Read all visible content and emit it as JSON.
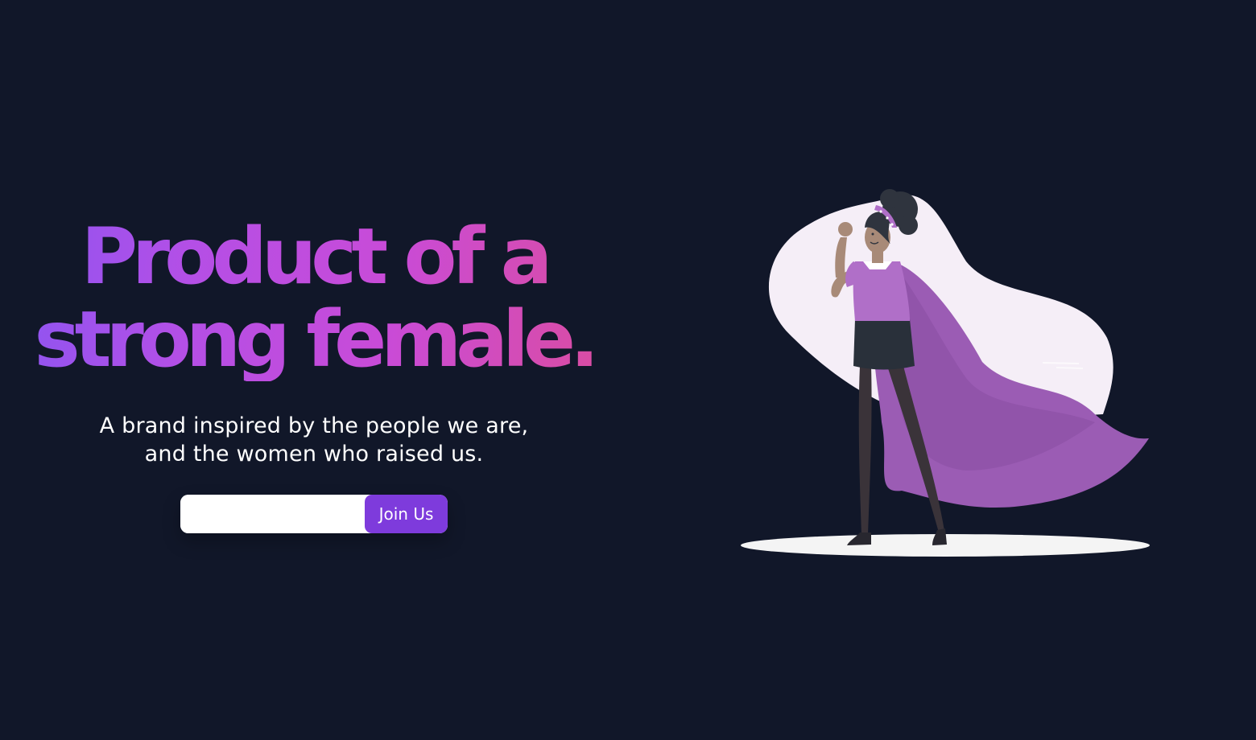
{
  "hero": {
    "headline_line1": "Product of a",
    "headline_line2": "strong female.",
    "subtitle_line1": "A brand inspired by the people we are,",
    "subtitle_line2": "and the women who raised us.",
    "email_input": {
      "value": "",
      "placeholder": ""
    },
    "cta_label": "Join Us"
  },
  "illustration": {
    "name": "superhero-woman-illustration"
  },
  "colors": {
    "background": "#111729",
    "headline_gradient_start": "#8a55f2",
    "headline_gradient_end": "#dc4d9c",
    "cta_button": "#7e3bdc",
    "cape": "#9b5cb4",
    "blob": "#f5eef7"
  }
}
